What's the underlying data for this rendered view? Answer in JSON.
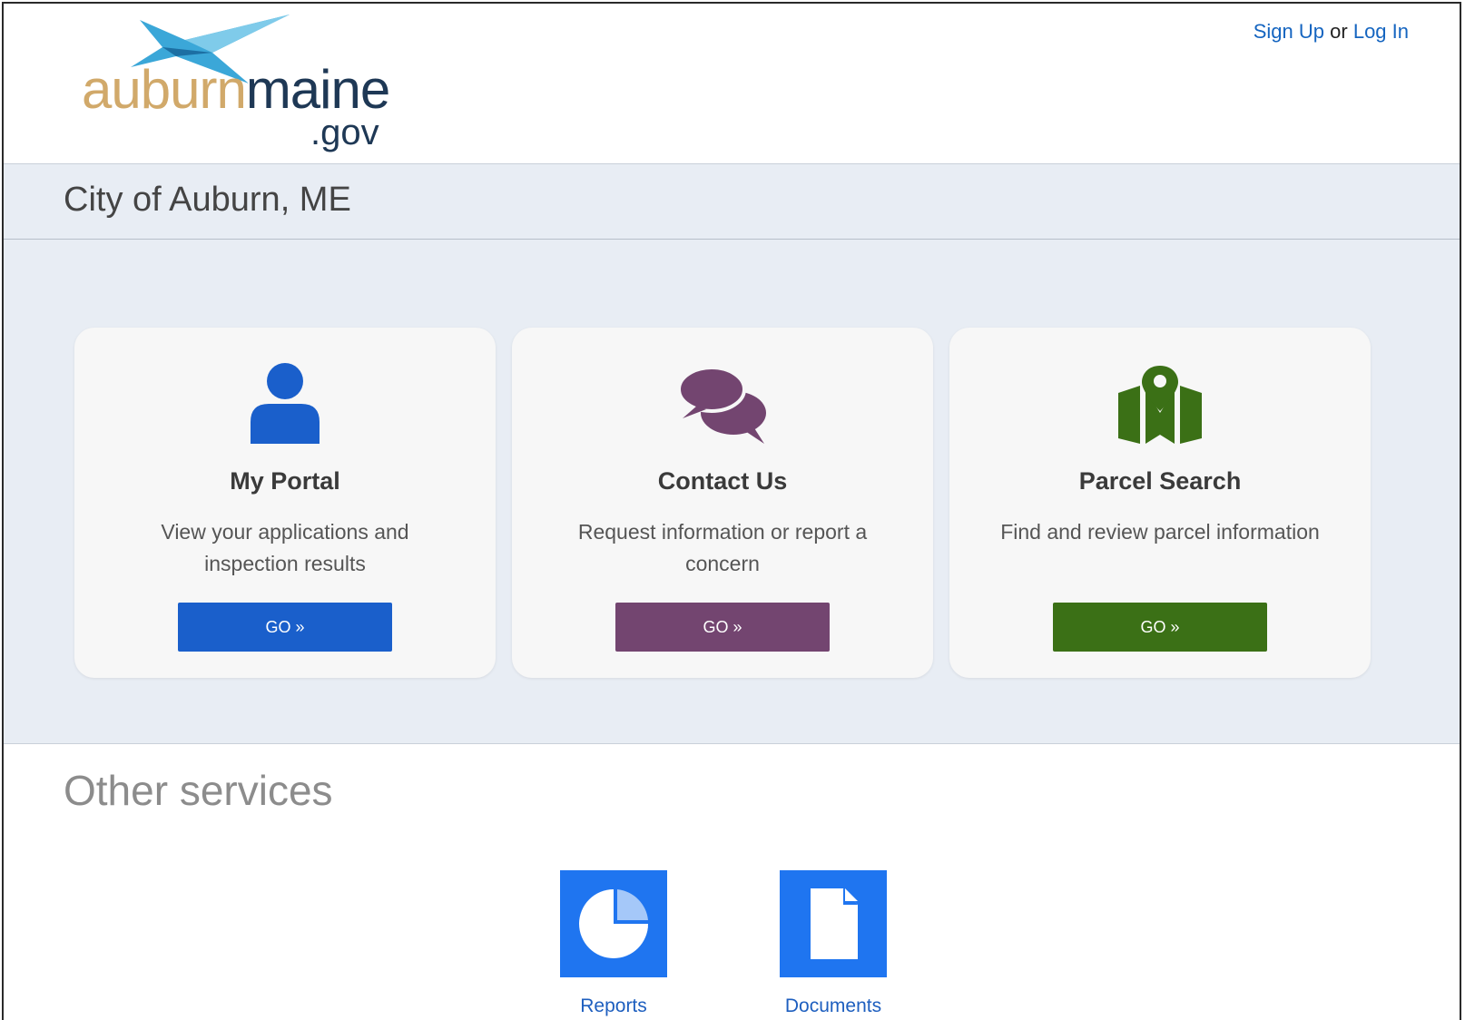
{
  "header": {
    "logo": {
      "part1": "auburn",
      "part2": "maine",
      "suffix": ".gov"
    },
    "auth": {
      "signup": "Sign Up",
      "separator": "or",
      "login": "Log In"
    }
  },
  "page": {
    "title": "City of Auburn, ME"
  },
  "cards": [
    {
      "icon": "user-icon",
      "color": "#1a5fcb",
      "title": "My Portal",
      "description": "View your applications and inspection results",
      "button": "GO »"
    },
    {
      "icon": "chat-bubbles-icon",
      "color": "#734570",
      "title": "Contact Us",
      "description": "Request information or report a concern",
      "button": "GO »"
    },
    {
      "icon": "map-pin-icon",
      "color": "#3b7016",
      "title": "Parcel Search",
      "description": "Find and review parcel information",
      "button": "GO »"
    }
  ],
  "other_services": {
    "title": "Other services",
    "items": [
      {
        "icon": "pie-chart-icon",
        "label": "Reports"
      },
      {
        "icon": "document-icon",
        "label": "Documents"
      }
    ]
  },
  "colors": {
    "accent_blue": "#1f75f0",
    "link": "#1565c0",
    "band_bg": "#e8edf4"
  }
}
